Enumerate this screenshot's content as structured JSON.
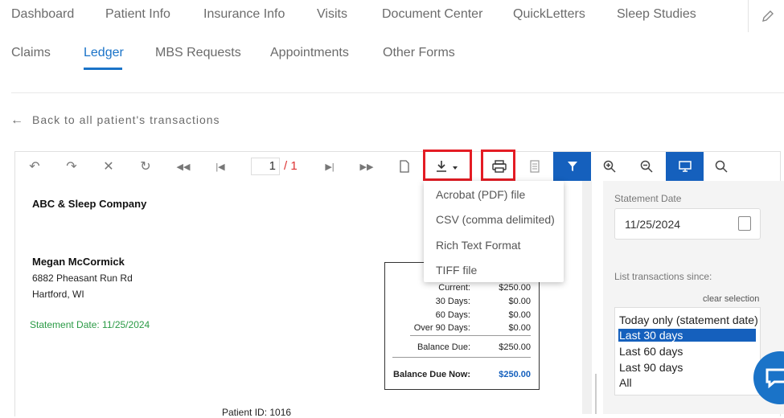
{
  "nav": {
    "top": [
      "Dashboard",
      "Patient Info",
      "Insurance Info",
      "Visits",
      "Document Center",
      "QuickLetters",
      "Sleep Studies"
    ],
    "sub": [
      "Claims",
      "Ledger",
      "MBS Requests",
      "Appointments",
      "Other Forms"
    ],
    "active": "Ledger"
  },
  "back_link": "Back to all patient's transactions",
  "viewer": {
    "page_current": "1",
    "page_total": "/ 1",
    "export_menu": [
      "Acrobat (PDF) file",
      "CSV (comma delimited)",
      "Rich Text Format",
      "TIFF file"
    ]
  },
  "report": {
    "company": "ABC & Sleep Company",
    "patient_name": "Megan McCormick",
    "address1": "6882 Pheasant Run Rd",
    "address2": "Hartford, WI",
    "statement_date": "Statement Date: 11/25/2024",
    "patient_id": "Patient ID: 1016",
    "aging": [
      {
        "label": "Current:",
        "value": "$250.00"
      },
      {
        "label": "30 Days:",
        "value": "$0.00"
      },
      {
        "label": "60 Days:",
        "value": "$0.00"
      },
      {
        "label": "Over 90 Days:",
        "value": "$0.00"
      }
    ],
    "balance_due_label": "Balance Due:",
    "balance_due": "$250.00",
    "balance_due_now_label": "Balance Due Now:",
    "balance_due_now": "$250.00"
  },
  "panel": {
    "statement_date_label": "Statement Date",
    "statement_date_value": "11/25/2024",
    "list_label": "List transactions since:",
    "clear_selection": "clear selection",
    "options": [
      "Today only (statement date)",
      "Last 30 days",
      "Last 60 days",
      "Last 90 days",
      "All"
    ],
    "selected": "Last 30 days"
  },
  "colors": {
    "accent": "#1a73c8",
    "toolbar_active": "#1560bd",
    "highlight_box": "#e41c24",
    "statement_green": "#2a9a45"
  }
}
